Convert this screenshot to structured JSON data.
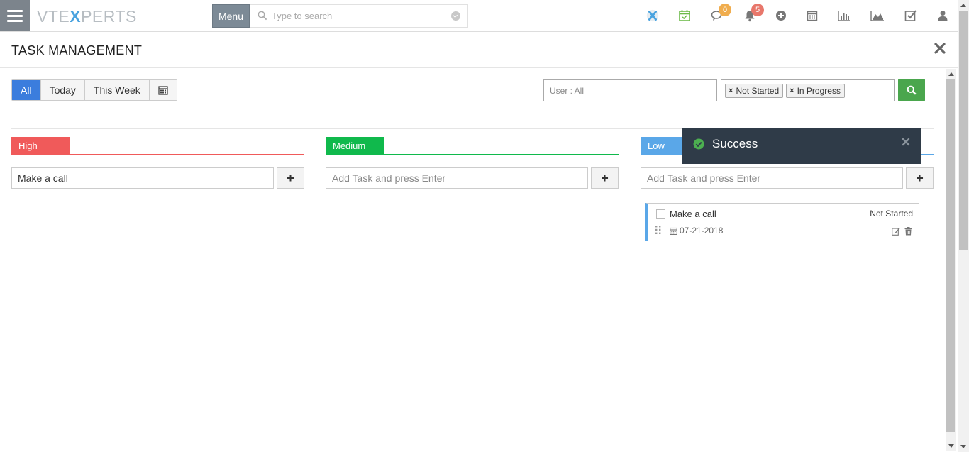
{
  "topbar": {
    "logo_prefix": "VTE",
    "logo_x": "X",
    "logo_suffix": "PERTS",
    "menu_label": "Menu",
    "search_placeholder": "Type to search",
    "chat_badge": "0",
    "notification_badge": "5",
    "colors": {
      "chat_badge": "#f0ad4e",
      "notification_badge": "#e8776b",
      "hamburger": "#7c848c"
    }
  },
  "panel": {
    "title": "TASK MANAGEMENT",
    "filters": [
      {
        "label": "All",
        "active": true
      },
      {
        "label": "Today",
        "active": false
      },
      {
        "label": "This Week",
        "active": false
      }
    ],
    "user_filter": "User : All",
    "status_tags": [
      "Not Started",
      "In Progress"
    ]
  },
  "columns": [
    {
      "label": "High",
      "color": "#f05a5a",
      "input_value": "Make a call",
      "input_placeholder": "Add Task and press Enter"
    },
    {
      "label": "Medium",
      "color": "#10b94c",
      "input_value": "",
      "input_placeholder": "Add Task and press Enter"
    },
    {
      "label": "Low",
      "color": "#5aa7e8",
      "input_value": "",
      "input_placeholder": "Add Task and press Enter"
    }
  ],
  "task": {
    "name": "Make a call",
    "status": "Not Started",
    "date": "07-21-2018"
  },
  "toast": {
    "message": "Success",
    "color": "#2f3b48"
  }
}
